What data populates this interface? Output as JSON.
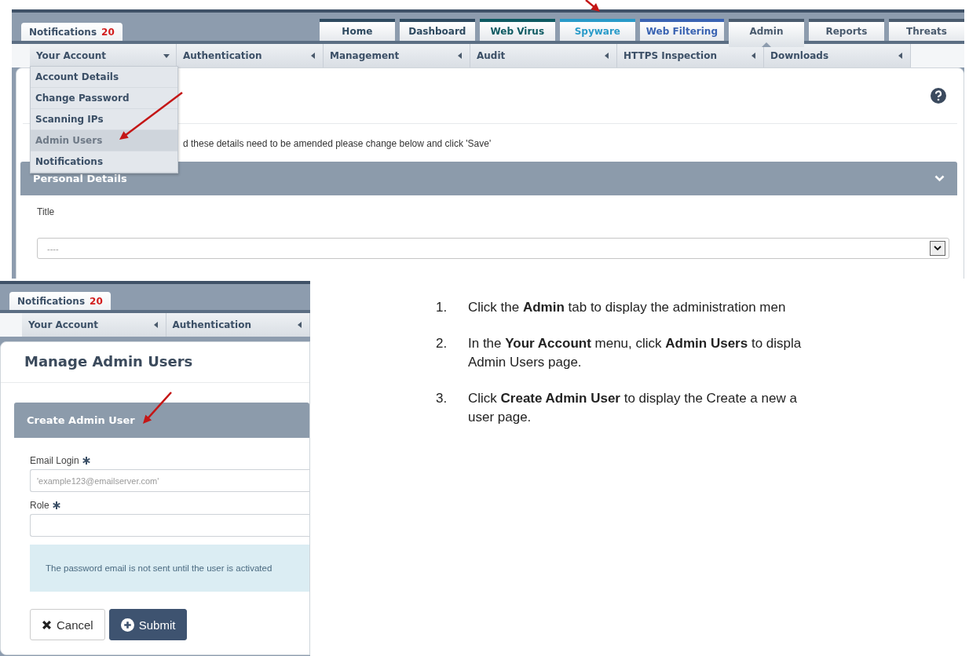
{
  "top_screenshot": {
    "notification_tab": {
      "label": "Notifications",
      "count": "20"
    },
    "tabs": [
      {
        "label": "Home",
        "selected": false,
        "color": "#2f4a60"
      },
      {
        "label": "Dashboard",
        "selected": false,
        "color": "#2f4a60"
      },
      {
        "label": "Web Virus",
        "selected": false,
        "color": "#0e5a62"
      },
      {
        "label": "Spyware",
        "selected": false,
        "color": "#2a9bc9"
      },
      {
        "label": "Web Filtering",
        "selected": false,
        "color": "#3a63b2"
      },
      {
        "label": "Admin",
        "selected": true,
        "color": "#4a5b6e"
      },
      {
        "label": "Reports",
        "selected": false,
        "color": "#4a5b6e"
      },
      {
        "label": "Threats",
        "selected": false,
        "color": "#4a5b6e"
      }
    ],
    "submenu": [
      {
        "label": "Your Account",
        "expanded": true
      },
      {
        "label": "Authentication",
        "expanded": false
      },
      {
        "label": "Management",
        "expanded": false
      },
      {
        "label": "Audit",
        "expanded": false
      },
      {
        "label": "HTTPS Inspection",
        "expanded": false
      },
      {
        "label": "Downloads",
        "expanded": false
      }
    ],
    "dropdown": [
      {
        "label": "Account Details",
        "selected": false
      },
      {
        "label": "Change Password",
        "selected": false
      },
      {
        "label": "Scanning IPs",
        "selected": false
      },
      {
        "label": "Admin Users",
        "selected": true
      },
      {
        "label": "Notifications",
        "selected": false
      }
    ],
    "intro_text": "d these details need to be amended please change below and click 'Save'",
    "section_title": "Personal Details",
    "title_field": {
      "label": "Title",
      "value": "----"
    }
  },
  "bottom_screenshot": {
    "notification_tab": {
      "label": "Notifications",
      "count": "20"
    },
    "submenu": [
      {
        "label": "Your Account",
        "expanded": false
      },
      {
        "label": "Authentication",
        "expanded": false
      }
    ],
    "heading": "Manage Admin Users",
    "section_title": "Create Admin User",
    "fields": [
      {
        "label": "Email Login",
        "required": true,
        "placeholder": "'example123@emailserver.com'"
      },
      {
        "label": "Role",
        "required": true
      }
    ],
    "info_text": "The password email is not sent until the user is activated",
    "buttons": [
      {
        "label": "Cancel",
        "kind": "cancel"
      },
      {
        "label": "Submit",
        "kind": "submit"
      }
    ]
  },
  "instructions": [
    {
      "number": "1.",
      "lines": [
        "Click the **Admin** tab to display the administration men"
      ]
    },
    {
      "number": "2.",
      "lines": [
        "In the **Your Account** menu, click **Admin Users** to displa",
        "Admin Users page."
      ]
    },
    {
      "number": "3.",
      "lines": [
        "Click **Create Admin User** to display the Create a new a",
        "user page."
      ]
    }
  ]
}
